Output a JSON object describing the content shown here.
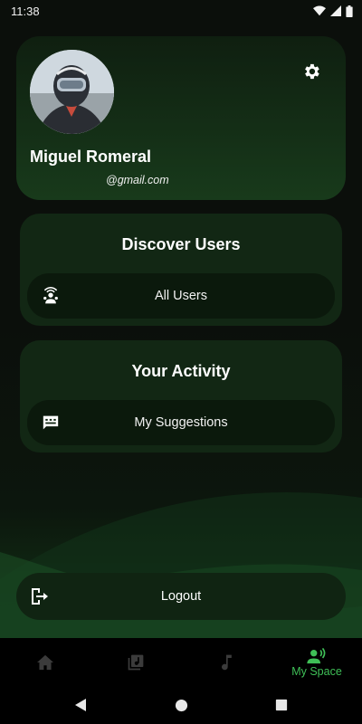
{
  "status_bar": {
    "time": "11:38",
    "icons": [
      "wifi-icon",
      "signal-icon",
      "battery-icon"
    ]
  },
  "profile": {
    "name": "Miguel Romeral",
    "email": "@gmail.com",
    "avatar_icon": "avatar",
    "settings_icon": "gear-icon"
  },
  "discover": {
    "title": "Discover Users",
    "item_label": "All Users",
    "item_icon": "users-wifi-icon"
  },
  "activity": {
    "title": "Your Activity",
    "item_label": "My Suggestions",
    "item_icon": "message-icon"
  },
  "logout": {
    "label": "Logout",
    "icon": "logout-icon"
  },
  "bottom_nav": {
    "items": [
      {
        "icon": "home-icon",
        "label": ""
      },
      {
        "icon": "library-music-icon",
        "label": ""
      },
      {
        "icon": "music-note-icon",
        "label": ""
      },
      {
        "icon": "record-voice-icon",
        "label": "My Space",
        "active": true
      }
    ]
  },
  "colors": {
    "accent": "#3fbf57",
    "card": "#122714",
    "background": "#0b0f0b"
  }
}
